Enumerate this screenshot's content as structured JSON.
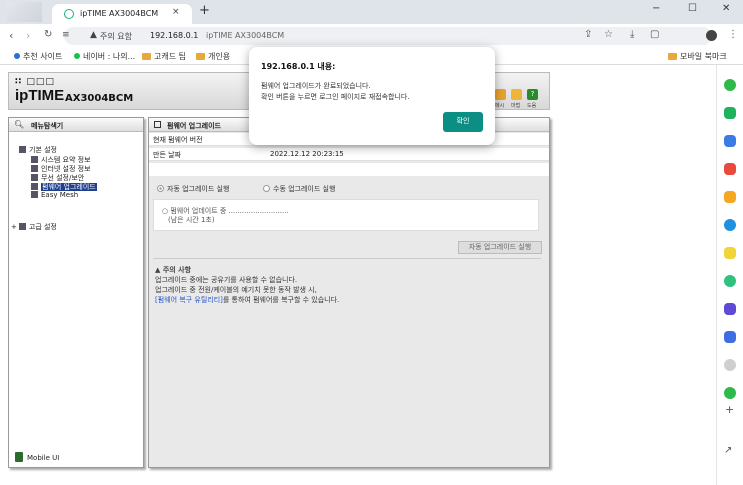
{
  "browser": {
    "tab_title": "ipTIME AX3004BCM",
    "tab_close": "×",
    "new_tab": "+",
    "window_controls": [
      "−",
      "☐",
      "✕"
    ],
    "nav": {
      "back": "‹",
      "forward": "›",
      "reload": "↻",
      "reader": "≡"
    },
    "omnibox": {
      "warning_icon": "warning-icon",
      "status": "주의 요함",
      "host": "192.168.0.1",
      "path": "ipTIME AX3004BCM"
    },
    "toolbar_icons": [
      "share-icon",
      "star-icon",
      "download-icon",
      "profile-icon",
      "menu-icon"
    ],
    "bookmarks": [
      "추천 사이트",
      "네이버 : 나의...",
      "고캐드 팁",
      "개인용"
    ],
    "bookmarks_right": "모바일 북마크"
  },
  "router": {
    "logo_dots": "∷ □□□",
    "logo": "ipTIME",
    "model": "AX3004BCM",
    "header_icons": [
      {
        "name": "easymesh",
        "label": "메시",
        "color": "#e8a22f"
      },
      {
        "name": "setup",
        "label": "마법",
        "color": "#f0b43a"
      },
      {
        "name": "help",
        "label": "도움",
        "color": "#2c8a2c"
      }
    ]
  },
  "menu": {
    "title": "메뉴탐색기",
    "basic_settings": "기본 설정",
    "items": [
      "시스템 요약 정보",
      "인터넷 설정 정보",
      "무선 설정/보안",
      "펌웨어 업그레이드",
      "Easy Mesh"
    ],
    "selected_index": 3,
    "advanced_settings": "고급 설정",
    "mobile_ui": "Mobile UI"
  },
  "content": {
    "title": "펌웨어 업그레이드",
    "rows": [
      {
        "key": "현재 펌웨어 버전",
        "value": ""
      },
      {
        "key": "만든 날짜",
        "value": "2022.12.12 20:23:15"
      }
    ],
    "radio_auto": "자동 업그레이드 실행",
    "radio_manual": "수동 업그레이드 실행",
    "progress_line1": "펌웨어 업데이트 중 ...........................",
    "progress_line2": "(남은 시간 1초)",
    "auto_button": "자동 업그레이드 실행",
    "notice_title": "주의 사항",
    "notice_line1": "업그레이드 중에는 공유기를 사용할 수 없습니다.",
    "notice_line2": "업그레이드 중 전원/케이블의 예기치 못한 동작 발생 시,",
    "notice_link": "[펌웨어 복구 유틸리티]",
    "notice_line3": "를 통하여 펌웨어를 복구할 수 있습니다."
  },
  "dialog": {
    "title": "192.168.0.1 내용:",
    "message1": "펌웨어 업그레이드가 완료되었습니다.",
    "message2": "확인 버튼을 누르면 로그인 페이지로 재접속합니다.",
    "ok": "확인",
    "ok_color": "#0b8f84"
  }
}
